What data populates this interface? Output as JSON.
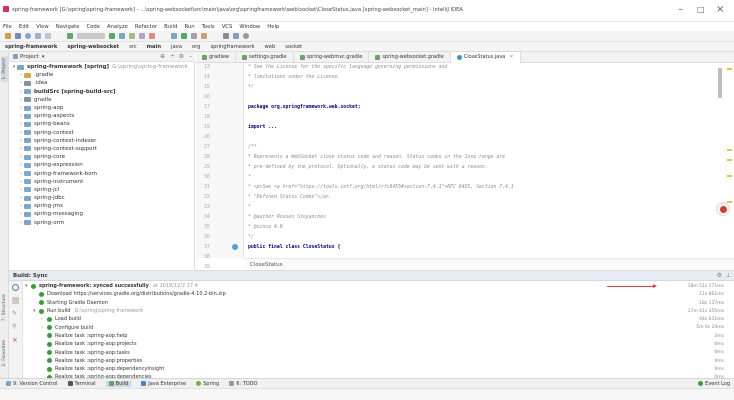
{
  "window": {
    "title": "spring-framework [G:\\spring\\spring-framework] - ...\\spring-websocket\\src\\main\\java\\org\\springframework\\web\\socket\\CloseStatus.java [spring-websocket_main] - IntelliJ IDEA",
    "controls": [
      "–",
      "□",
      "×"
    ]
  },
  "menu": [
    "File",
    "Edit",
    "View",
    "Navigate",
    "Code",
    "Analyze",
    "Refactor",
    "Build",
    "Run",
    "Tools",
    "VCS",
    "Window",
    "Help"
  ],
  "nav": {
    "crumbs": [
      "spring-framework",
      "spring-websocket",
      "src",
      "main",
      "java",
      "org",
      "springframework",
      "web",
      "socket"
    ]
  },
  "sidebar": {
    "project_tab": "1: Project",
    "structure_tab": "7: Structure",
    "favorites_tab": "2: Favorites"
  },
  "project": {
    "title": "Project",
    "root": "spring-framework [spring]",
    "root_path": "G:\\spring\\spring-framework",
    "items": [
      ".gradle",
      ".idea",
      "buildSrc [spring-build-src]",
      "gradle",
      "spring-aop",
      "spring-aspects",
      "spring-beans",
      "spring-context",
      "spring-context-indexer",
      "spring-context-support",
      "spring-core",
      "spring-expression",
      "spring-framework-bom",
      "spring-instrument",
      "spring-jcl",
      "spring-jdbc",
      "spring-jms",
      "spring-messaging",
      "spring-orm"
    ]
  },
  "editor": {
    "tabs": [
      "gradlew",
      "settings.gradle",
      "spring-webmvc.gradle",
      "spring-websocket.gradle",
      "CloseStatus.java"
    ],
    "lines": [
      {
        "n": "13",
        "t": " * See the License for the specific language governing permissions and",
        "c": "cm"
      },
      {
        "n": "14",
        "t": " * limitations under the License.",
        "c": "cm"
      },
      {
        "n": "15",
        "t": " */",
        "c": "cm"
      },
      {
        "n": "16",
        "t": "",
        "c": ""
      },
      {
        "n": "17",
        "t": "package org.springframework.web.socket;",
        "c": "kw"
      },
      {
        "n": "18",
        "t": "",
        "c": ""
      },
      {
        "n": "19",
        "t": "import ...",
        "c": "kw"
      },
      {
        "n": "26",
        "t": "",
        "c": ""
      },
      {
        "n": "27",
        "t": "/**",
        "c": "cm"
      },
      {
        "n": "28",
        "t": " * Represents a WebSocket close status code and reason. Status codes in the 1xxx range are",
        "c": "cm"
      },
      {
        "n": "29",
        "t": " * pre-defined by the protocol. Optionally, a status code may be sent with a reason.",
        "c": "cm"
      },
      {
        "n": "30",
        "t": " *",
        "c": "cm"
      },
      {
        "n": "31",
        "t": " * <p>See <a href=\"https://tools.ietf.org/html/rfc6455#section-7.4.1\">RFC 6455, Section 7.4.1",
        "c": "cm"
      },
      {
        "n": "32",
        "t": " * \"Defined Status Codes\"</a>.",
        "c": "cm"
      },
      {
        "n": "33",
        "t": " *",
        "c": "cm"
      },
      {
        "n": "34",
        "t": " * @author Rossen Stoyanchev",
        "c": "cm"
      },
      {
        "n": "35",
        "t": " * @since 4.0",
        "c": "cm"
      },
      {
        "n": "36",
        "t": " */",
        "c": "cm"
      },
      {
        "n": "37",
        "t": "public final class CloseStatus {",
        "c": "kw"
      },
      {
        "n": "38",
        "t": "",
        "c": ""
      },
      {
        "n": "39",
        "t": "    /**",
        "c": "cm"
      }
    ],
    "breadcrumb": "CloseStatus"
  },
  "build": {
    "title": "Build: Sync",
    "lines": [
      {
        "text": "spring-framework: synced successfully",
        "extra": "at 2018/12/2 17:4",
        "indent": 0,
        "bold": true
      },
      {
        "text": "Download https://services.gradle.org/distributions/gradle-4.10.2-bin.zip",
        "extra": "",
        "indent": 1
      },
      {
        "text": "Starting Gradle Daemon",
        "extra": "",
        "indent": 1
      },
      {
        "text": "Run build",
        "extra": "G:\\spring\\spring-framework",
        "indent": 1
      },
      {
        "text": "Load build",
        "extra": "",
        "indent": 2
      },
      {
        "text": "Configure build",
        "extra": "",
        "indent": 2
      },
      {
        "text": "Realize task :spring-aop:help",
        "extra": "",
        "indent": 2
      },
      {
        "text": "Realize task :spring-aop:projects",
        "extra": "",
        "indent": 2
      },
      {
        "text": "Realize task :spring-aop:tasks",
        "extra": "",
        "indent": 2
      },
      {
        "text": "Realize task :spring-aop:properties",
        "extra": "",
        "indent": 2
      },
      {
        "text": "Realize task :spring-aop:dependencyInsight",
        "extra": "",
        "indent": 2
      },
      {
        "text": "Realize task :spring-aop:dependencies",
        "extra": "",
        "indent": 2
      }
    ],
    "times": [
      "18m 51s 171ms",
      "11s 861ms",
      "18s 137ms",
      "17m 41s 355ms",
      "44s 631ms",
      "5m 9s 24ms",
      "3ms",
      "0ms",
      "0ms",
      "0ms",
      "0ms",
      "0ms"
    ]
  },
  "statusbar": {
    "items": [
      "9: Version Control",
      "Terminal",
      "Build",
      "Java Enterprise",
      "Spring",
      "6: TODO"
    ],
    "event_log": "Event Log"
  },
  "colors": {
    "accent": "#3875d7",
    "folder": "#87939a",
    "module": "#7ea6c9",
    "success": "#3a9b3a",
    "arrow": "#e04040",
    "warn": "#f0c040"
  }
}
